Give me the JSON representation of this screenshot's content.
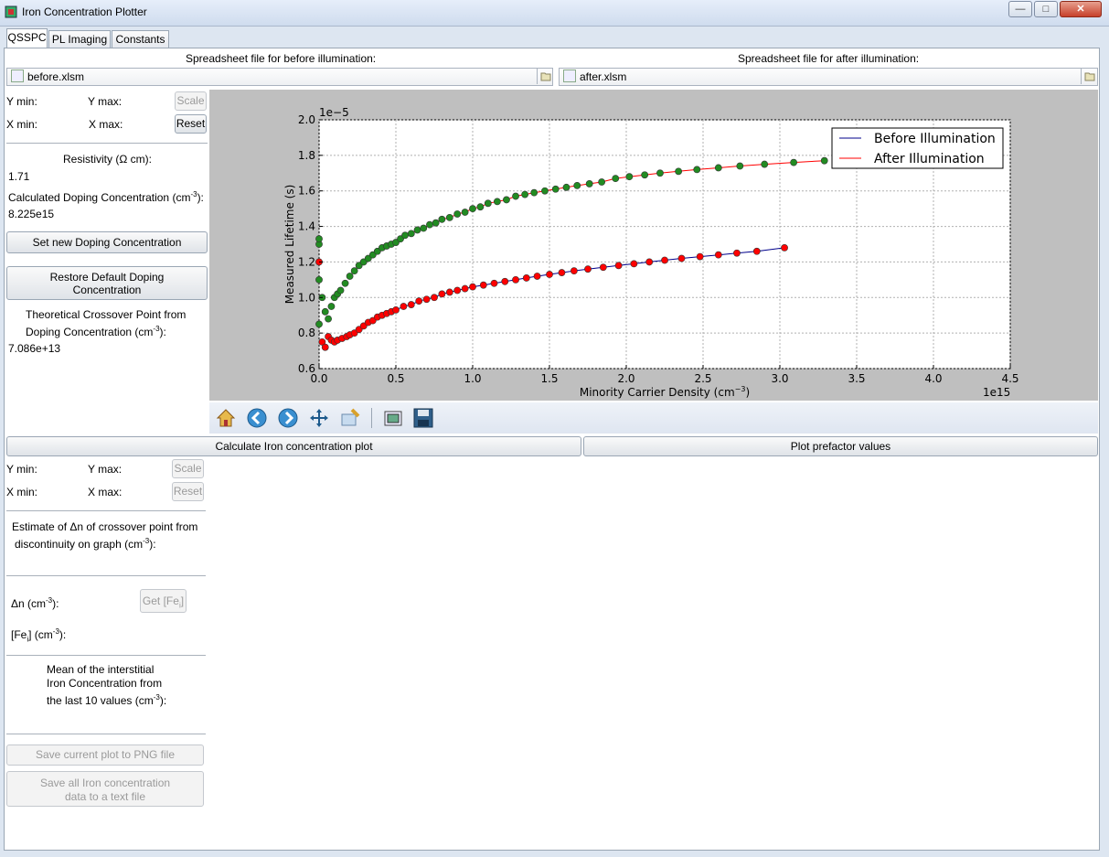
{
  "window": {
    "title": "Iron Concentration Plotter",
    "min_label": "—",
    "max_label": "□",
    "close_label": "✕"
  },
  "tabs": [
    "QSSPC",
    "PL Imaging",
    "Constants"
  ],
  "files": {
    "before_label": "Spreadsheet file for before illumination:",
    "before_value": "before.xlsm",
    "after_label": "Spreadsheet file for after illumination:",
    "after_value": "after.xlsm"
  },
  "axis_controls_top": {
    "ymin": "Y min:",
    "ymax": "Y  max:",
    "xmin": "X min:",
    "xmax": "X max:",
    "scale": "Scale",
    "reset": "Reset"
  },
  "resistivity": {
    "label": "Resistivity (Ω cm):",
    "value": "1.71",
    "doping_label": "Calculated Doping Concentration (cm",
    "doping_exp": "-3",
    "doping_value": "8.225e15",
    "set_button": "Set new Doping Concentration",
    "restore_button_line1": "Restore Default Doping",
    "restore_button_line2": "Concentration",
    "crossover_line1": "Theoretical Crossover Point from",
    "crossover_line2": "Doping Concentration (cm",
    "crossover_exp": "-3",
    "crossover_value": "7.086e+13"
  },
  "toolbar": {
    "icons": [
      "home-icon",
      "back-icon",
      "forward-icon",
      "pan-icon",
      "zoom-icon",
      "subplots-icon",
      "save-icon"
    ]
  },
  "actions": {
    "calc_button": "Calculate Iron concentration plot",
    "prefactor_button": "Plot prefactor values"
  },
  "axis_controls_bottom": {
    "ymin": "Y min:",
    "ymax": "Y max:",
    "xmin": "X min:",
    "xmax": "X max:",
    "scale": "Scale",
    "reset": "Reset"
  },
  "estimate": {
    "line1": "Estimate of Δn of crossover point from",
    "line2": "discontinuity on graph (cm",
    "exp": "-3"
  },
  "fe": {
    "dn_label": "Δn (cm",
    "dn_exp": "-3",
    "fe_label": "[Fe",
    "fe_sub": "i",
    "fe_tail": "] (cm",
    "fe_exp": "-3",
    "get_button": "Get [Fe",
    "get_sub": "i",
    "get_tail": "]",
    "mean_line1": "Mean of the interstitial",
    "mean_line2": "Iron Concentration from",
    "mean_line3": "the last 10 values (cm",
    "mean_exp": "-3"
  },
  "save": {
    "png_button": "Save current plot to PNG file",
    "txt_line1": "Save all Iron concentration",
    "txt_line2": "data to a text file"
  },
  "chart_data": {
    "type": "scatter",
    "xlabel": "Minority Carrier Density (cm",
    "xlabel_exp": "−3",
    "ylabel": "Measured Lifetime (s)",
    "x_offset_label": "1e15",
    "y_offset_label": "1e−5",
    "xlim": [
      0.0,
      4.5
    ],
    "ylim": [
      0.6,
      2.0
    ],
    "xticks": [
      "0.0",
      "0.5",
      "1.0",
      "1.5",
      "2.0",
      "2.5",
      "3.0",
      "3.5",
      "4.0",
      "4.5"
    ],
    "yticks": [
      "0.6",
      "0.8",
      "1.0",
      "1.2",
      "1.4",
      "1.6",
      "1.8",
      "2.0"
    ],
    "grid": true,
    "legend_position": "top-right",
    "legend": [
      "Before Illumination",
      "After Illumination"
    ],
    "colors": {
      "before": "#00008b",
      "after": "#ff0000",
      "green_points": "#228b22",
      "red_points": "#ff0000"
    },
    "series": [
      {
        "name": "Before Illumination",
        "marker_color": "#ff0000",
        "line_color": "#00008b",
        "x": [
          0.0,
          0.02,
          0.04,
          0.06,
          0.08,
          0.1,
          0.12,
          0.15,
          0.18,
          0.2,
          0.23,
          0.26,
          0.29,
          0.32,
          0.35,
          0.38,
          0.41,
          0.44,
          0.47,
          0.5,
          0.55,
          0.6,
          0.65,
          0.7,
          0.75,
          0.8,
          0.85,
          0.9,
          0.95,
          1.0,
          1.07,
          1.14,
          1.21,
          1.28,
          1.35,
          1.42,
          1.5,
          1.58,
          1.66,
          1.75,
          1.85,
          1.95,
          2.05,
          2.15,
          2.25,
          2.36,
          2.48,
          2.6,
          2.72,
          2.85,
          3.03
        ],
        "y": [
          1.2,
          0.75,
          0.72,
          0.78,
          0.76,
          0.75,
          0.76,
          0.77,
          0.78,
          0.79,
          0.8,
          0.82,
          0.84,
          0.86,
          0.87,
          0.89,
          0.9,
          0.91,
          0.92,
          0.93,
          0.95,
          0.96,
          0.98,
          0.99,
          1.0,
          1.02,
          1.03,
          1.04,
          1.05,
          1.06,
          1.07,
          1.08,
          1.09,
          1.1,
          1.11,
          1.12,
          1.13,
          1.14,
          1.15,
          1.16,
          1.17,
          1.18,
          1.19,
          1.2,
          1.21,
          1.22,
          1.23,
          1.24,
          1.25,
          1.26,
          1.28
        ]
      },
      {
        "name": "After Illumination",
        "marker_color": "#228b22",
        "line_color": "#ff0000",
        "x": [
          0.0,
          0.0,
          0.0,
          0.0,
          0.02,
          0.04,
          0.06,
          0.08,
          0.1,
          0.12,
          0.14,
          0.17,
          0.2,
          0.23,
          0.26,
          0.29,
          0.32,
          0.35,
          0.38,
          0.41,
          0.44,
          0.47,
          0.5,
          0.53,
          0.56,
          0.6,
          0.64,
          0.68,
          0.72,
          0.76,
          0.8,
          0.85,
          0.9,
          0.95,
          1.0,
          1.05,
          1.1,
          1.16,
          1.22,
          1.28,
          1.34,
          1.4,
          1.47,
          1.54,
          1.61,
          1.68,
          1.76,
          1.84,
          1.93,
          2.02,
          2.12,
          2.22,
          2.34,
          2.46,
          2.6,
          2.74,
          2.9,
          3.09,
          3.29
        ],
        "y": [
          0.85,
          1.1,
          1.3,
          1.33,
          1.0,
          0.92,
          0.88,
          0.95,
          1.0,
          1.02,
          1.04,
          1.08,
          1.12,
          1.15,
          1.18,
          1.2,
          1.22,
          1.24,
          1.26,
          1.28,
          1.29,
          1.3,
          1.31,
          1.33,
          1.35,
          1.36,
          1.38,
          1.39,
          1.41,
          1.42,
          1.44,
          1.45,
          1.47,
          1.48,
          1.5,
          1.51,
          1.53,
          1.54,
          1.55,
          1.57,
          1.58,
          1.59,
          1.6,
          1.61,
          1.62,
          1.63,
          1.64,
          1.65,
          1.67,
          1.68,
          1.69,
          1.7,
          1.71,
          1.72,
          1.73,
          1.74,
          1.75,
          1.76,
          1.77
        ]
      }
    ]
  }
}
